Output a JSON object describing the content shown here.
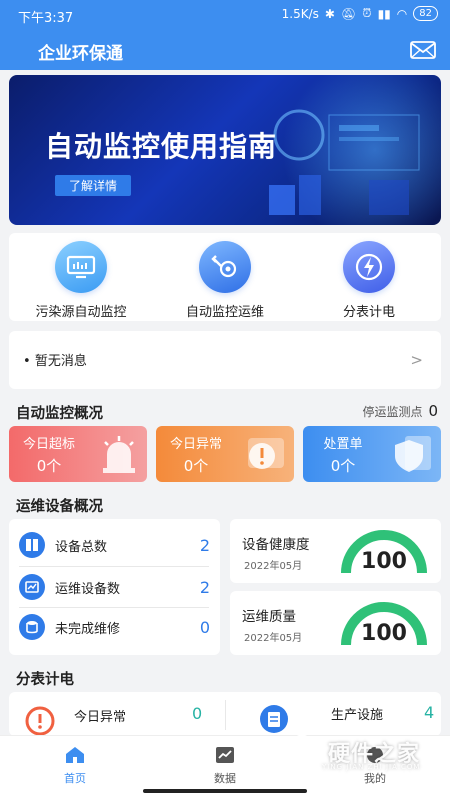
{
  "status": {
    "time": "下午3:37",
    "speed": "1.5K/s",
    "battery": "82"
  },
  "app": {
    "title": "企业环保通"
  },
  "banner": {
    "title": "自动监控使用指南",
    "button": "了解详情"
  },
  "quick": [
    {
      "label": "污染源自动监控",
      "icon": "monitor-icon"
    },
    {
      "label": "自动监控运维",
      "icon": "wrench-gear-icon"
    },
    {
      "label": "分表计电",
      "icon": "lightning-icon"
    }
  ],
  "message": {
    "text": "暂无消息"
  },
  "monitor": {
    "title": "自动监控概况",
    "stopped_label": "停运监测点",
    "stopped_value": "0",
    "cards": [
      {
        "label": "今日超标",
        "value": "0个",
        "color": "#f25a5a"
      },
      {
        "label": "今日异常",
        "value": "0个",
        "color": "#f6923f"
      },
      {
        "label": "处置单",
        "value": "0个",
        "color": "#3d8ef0"
      }
    ]
  },
  "devices": {
    "title": "运维设备概况",
    "rows": [
      {
        "label": "设备总数",
        "value": "2"
      },
      {
        "label": "运维设备数",
        "value": "2"
      },
      {
        "label": "未完成维修",
        "value": "0"
      }
    ],
    "gauges": [
      {
        "label": "设备健康度",
        "date": "2022年05月",
        "value": "100",
        "fraction": 1.0
      },
      {
        "label": "运维质量",
        "date": "2022年05月",
        "value": "100",
        "fraction": 1.0
      }
    ]
  },
  "meter": {
    "title": "分表计电",
    "items": [
      {
        "label": "今日异常",
        "value": "0"
      },
      {
        "label": "生产设施",
        "value": "4"
      }
    ]
  },
  "nav": [
    {
      "label": "首页",
      "active": true
    },
    {
      "label": "数据",
      "active": false
    },
    {
      "label": "我的",
      "active": false
    }
  ],
  "watermark": {
    "title": "硬件之家",
    "sub": "YING JIAN ZHI JIA.COM"
  },
  "colors": {
    "primary": "#3d8ef0",
    "green": "#2fc178",
    "red": "#f25a5a",
    "orange": "#f6923f",
    "teal": "#27b3a4"
  }
}
